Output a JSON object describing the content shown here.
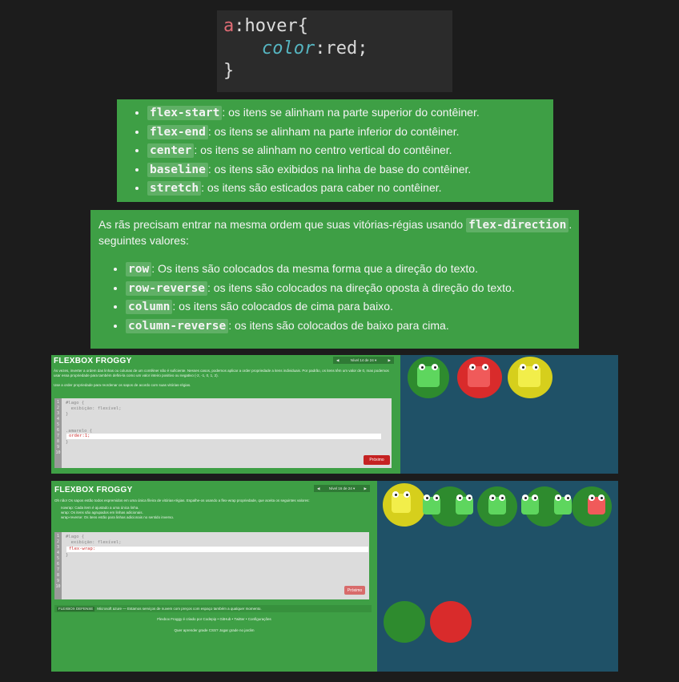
{
  "code_card": {
    "selector": "a",
    "pseudo": ":hover",
    "open_brace": "{",
    "property": "color",
    "colon": ":",
    "value": "red",
    "semicolon": ";",
    "close_brace": "}"
  },
  "align_items": [
    {
      "key": "flex-start",
      "desc": ": os itens se alinham na parte superior do contêiner."
    },
    {
      "key": "flex-end",
      "desc": ": os itens se alinham na parte inferior do contêiner."
    },
    {
      "key": "center",
      "desc": ": os itens se alinham no centro vertical do contêiner."
    },
    {
      "key": "baseline",
      "desc": ": os itens são exibidos na linha de base do contêiner."
    },
    {
      "key": "stretch",
      "desc": ": os itens são esticados para caber no contêiner."
    }
  ],
  "direction": {
    "intro_before": "As rãs precisam entrar na mesma ordem que suas vitórias-régias usando ",
    "intro_key": "flex-direction",
    "intro_after": ".",
    "intro_line2": "seguintes valores:",
    "items": [
      {
        "key": "row",
        "desc": ": Os itens são colocados da mesma forma que a direção do texto."
      },
      {
        "key": "row-reverse",
        "desc": ": os itens são colocados na direção oposta à direção do texto."
      },
      {
        "key": "column",
        "desc": ": os itens são colocados de cima para baixo."
      },
      {
        "key": "column-reverse",
        "desc": ": os itens são colocados de baixo para cima."
      }
    ]
  },
  "froggy1": {
    "title": "FLEXBOX FROGGY",
    "level": "Nível 14 de 24",
    "prev": "◀",
    "next": "▶",
    "caret": "▾",
    "text1": "Às vezes, inverter a ordem das linhas ou colunas de um contêiner não é suficiente. Nesses casos, podemos aplicar a order propriedade a itens individuais. Por padrão, os itens têm um valor de 0, mas podemos usar essa propriedade para também defini-la como um valor inteiro positivo ou negativo (-2, -1, 0, 1, 2).",
    "text2": "Use a order propriedade para reordenar os sapos de acordo com suas vitórias-régias.",
    "lines": [
      "1",
      "2",
      "3",
      "4",
      "5",
      "6",
      "7",
      "8",
      "9",
      "10"
    ],
    "code1": "#lago {",
    "code2": "  exibição: flexível;",
    "code3": "}",
    "code4": ".amarelo {",
    "input": "order:1;",
    "code5": "}",
    "next_button": "Próximo",
    "frogs": [
      "green",
      "red",
      "yellow"
    ]
  },
  "froggy2": {
    "title": "FLEXBOX FROGGY",
    "level": "Nível 16 de 24",
    "prev": "◀",
    "next": "▶",
    "caret": "▾",
    "text1": "Oh não! Os sapos estão todos espremidos em uma única fileira de vitórias-régias. Espalhe-os usando a flex-wrap propriedade, que aceita os seguintes valores:",
    "bullets": [
      "nowrap: Cada item é ajustado a uma única linha.",
      "wrap: Os itens são agrupados em linhas adicionais.",
      "wrap-reverse: Os itens estão para linhas adicionais no sentido inverso."
    ],
    "lines": [
      "1",
      "2",
      "3",
      "4",
      "5",
      "6",
      "7",
      "8",
      "9",
      "10"
    ],
    "code1": "#lago {",
    "code2": "  exibição: flexível;",
    "input": "flex-wrap:",
    "code3": "}",
    "next_button": "Próximo",
    "footer_badge": "FLEXBOX DEFENSE",
    "footer_text": "Microsoft azure — Estamos serviços de nuvem com preços com espaço também a qualquer momento.",
    "credits1": "Flexbox Froggy é criado por Codepip • GitHub • Twitter • Configurações",
    "credits2": "Quer aprender grade CSS? Jogar grade no jardim",
    "frogs": [
      "yellow",
      "green",
      "green",
      "green",
      "green",
      "green",
      "red"
    ]
  },
  "colors": {
    "green_box": "#3e9f45",
    "pond": "#1f5167",
    "frog_green": "#2e8b2e",
    "frog_red": "#d92b2b",
    "frog_yellow": "#d6cf1c"
  }
}
